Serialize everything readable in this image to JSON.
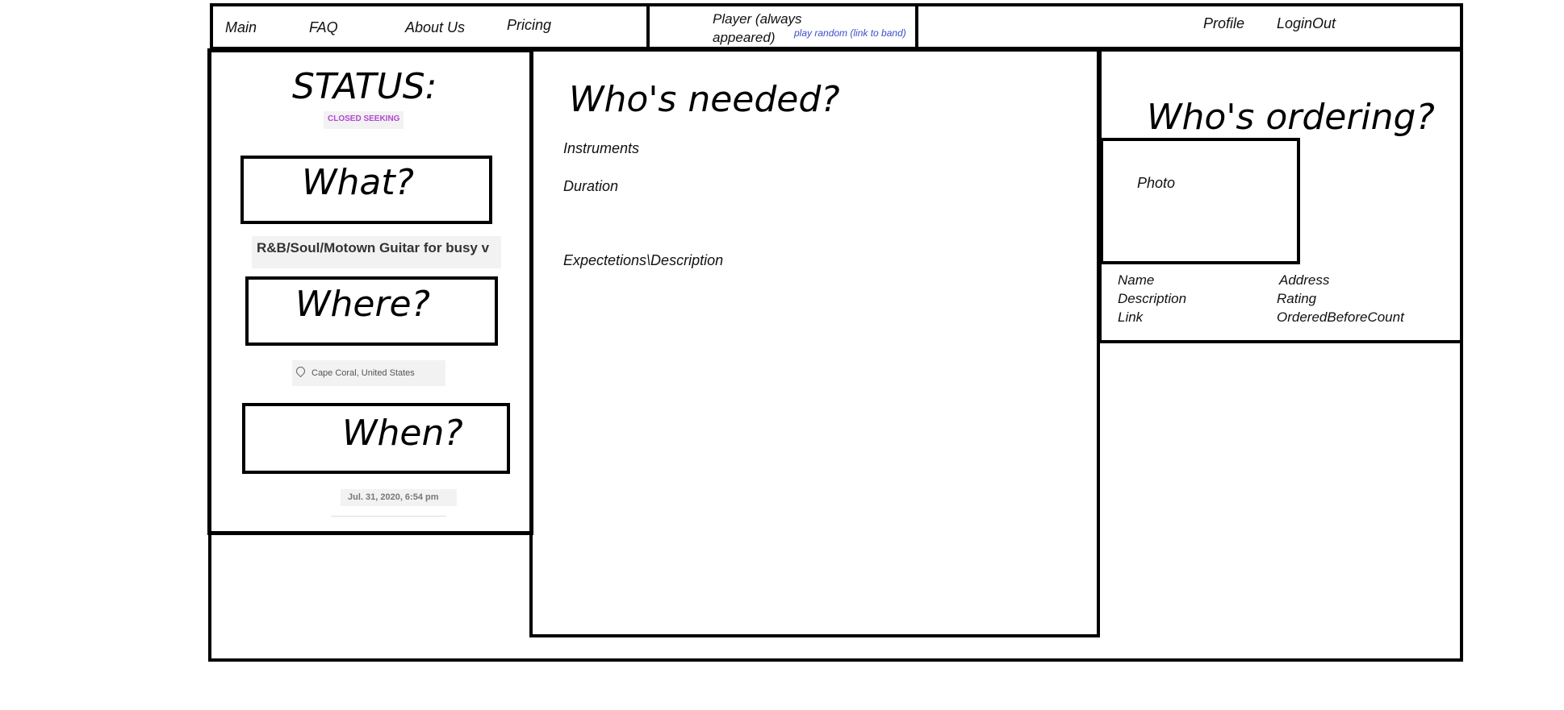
{
  "nav": {
    "main": "Main",
    "faq": "FAQ",
    "about": "About Us",
    "pricing": "Pricing",
    "player_line1": "Player (always",
    "player_line2": "appeared)",
    "play_random": "play random (link to band)",
    "profile": "Profile",
    "login": "LoginOut"
  },
  "left": {
    "status_heading": "STATUS:",
    "status_badge": "CLOSED SEEKING",
    "what_heading": "What?",
    "what_value": "R&B/Soul/Motown Guitar for busy v",
    "where_heading": "Where?",
    "where_value": "Cape Coral, United States",
    "when_heading": "When?",
    "when_value": "Jul. 31, 2020, 6:54 pm"
  },
  "center": {
    "heading": "Who's needed?",
    "instruments": "Instruments",
    "duration": "Duration",
    "description": "Expectetions\\Description"
  },
  "right": {
    "heading": "Who's ordering?",
    "photo": "Photo",
    "name": "Name",
    "address": "Address",
    "description": "Description",
    "rating": "Rating",
    "link": "Link",
    "ordered_before": "OrderedBeforeCount"
  },
  "colors": {
    "status_badge": "#b048d0",
    "play_random": "#3a4fc8",
    "snippet_bg": "#f2f2f2"
  }
}
